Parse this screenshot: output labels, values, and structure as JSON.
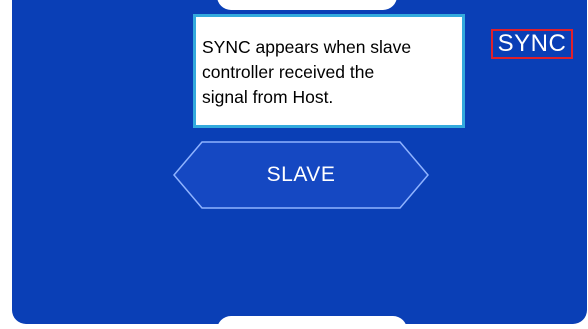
{
  "screen": {
    "background_color": "#0a3fb6"
  },
  "status": {
    "sync_label": "SYNC",
    "highlight_color": "#e0202a"
  },
  "callout": {
    "lines": [
      "SYNC appears when slave",
      "controller received the",
      "signal from Host."
    ],
    "border_color": "#33aadd"
  },
  "mode_button": {
    "label": "SLAVE"
  }
}
